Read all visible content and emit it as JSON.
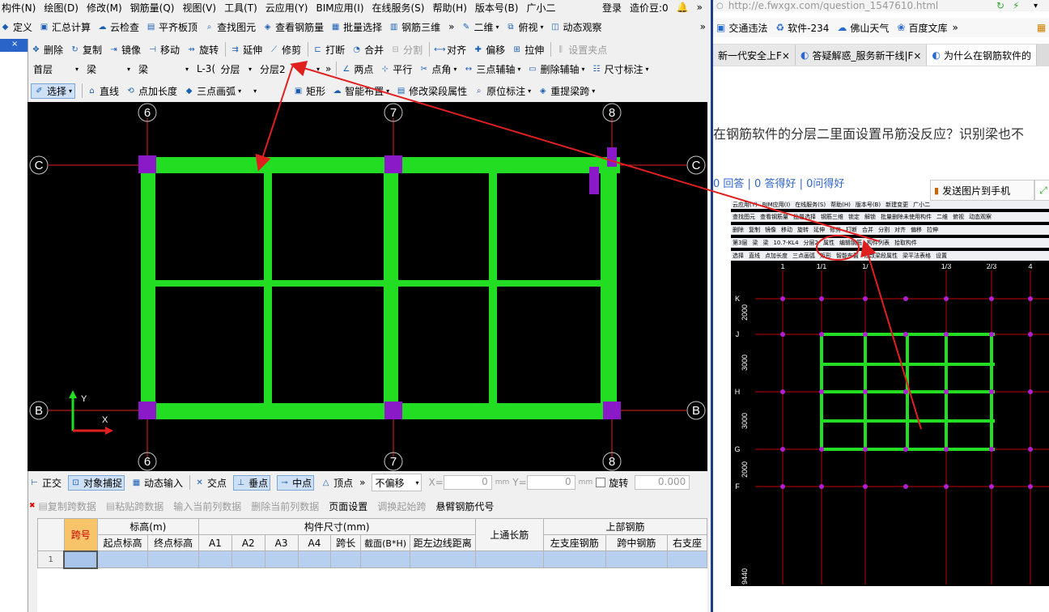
{
  "menubar": [
    "构件(N)",
    "绘图(D)",
    "修改(M)",
    "钢筋量(Q)",
    "视图(V)",
    "工具(T)",
    "云应用(Y)",
    "BIM应用(I)",
    "在线服务(S)",
    "帮助(H)",
    "版本号(B)",
    "广小二"
  ],
  "menubar_right": {
    "login": "登录",
    "coins": "造价豆:0"
  },
  "toolbar1": [
    {
      "label": "定义",
      "icon": "define-icon"
    },
    {
      "label": "汇总计算",
      "icon": "sigma-icon"
    },
    {
      "label": "云检查",
      "icon": "cloud-check-icon"
    },
    {
      "label": "平齐板顶",
      "icon": "align-slab-icon"
    },
    {
      "label": "查找图元",
      "icon": "find-icon"
    },
    {
      "label": "查看钢筋量",
      "icon": "view-rebar-icon"
    },
    {
      "label": "批量选择",
      "icon": "batch-select-icon"
    },
    {
      "label": "钢筋三维",
      "icon": "rebar-3d-icon"
    }
  ],
  "toolbar1_right": [
    {
      "label": "二维",
      "icon": "view-2d-icon"
    },
    {
      "label": "俯视",
      "icon": "top-view-icon"
    },
    {
      "label": "动态观察",
      "icon": "orbit-icon"
    }
  ],
  "toolbar2": [
    {
      "label": "删除",
      "icon": "delete-icon",
      "disabled": false
    },
    {
      "label": "复制",
      "icon": "copy-icon",
      "disabled": false
    },
    {
      "label": "镜像",
      "icon": "mirror-icon",
      "disabled": false
    },
    {
      "label": "移动",
      "icon": "move-icon",
      "disabled": false
    },
    {
      "label": "旋转",
      "icon": "rotate-icon",
      "disabled": false
    },
    {
      "label": "延伸",
      "icon": "extend-icon",
      "disabled": false
    },
    {
      "label": "修剪",
      "icon": "trim-icon",
      "disabled": false
    },
    {
      "label": "打断",
      "icon": "break-icon",
      "disabled": false
    },
    {
      "label": "合并",
      "icon": "merge-icon",
      "disabled": false
    },
    {
      "label": "分割",
      "icon": "split-icon",
      "disabled": true
    },
    {
      "label": "对齐",
      "icon": "align-icon",
      "disabled": false
    },
    {
      "label": "偏移",
      "icon": "offset-icon",
      "disabled": false
    },
    {
      "label": "拉伸",
      "icon": "stretch-icon",
      "disabled": false
    },
    {
      "label": "设置夹点",
      "icon": "grip-icon",
      "disabled": true
    }
  ],
  "toolbar3": {
    "floor": "首层",
    "category": "梁",
    "type": "梁",
    "member": "L-3(",
    "layer_label": "分层",
    "layer_value": "分层2"
  },
  "toolbar3_tools": [
    {
      "label": "两点",
      "icon": "two-point-icon"
    },
    {
      "label": "平行",
      "icon": "parallel-icon"
    },
    {
      "label": "点角",
      "icon": "point-angle-icon"
    },
    {
      "label": "三点辅轴",
      "icon": "three-point-axis-icon"
    },
    {
      "label": "删除辅轴",
      "icon": "delete-axis-icon"
    },
    {
      "label": "尺寸标注",
      "icon": "dimension-icon"
    }
  ],
  "toolbar4": [
    {
      "label": "选择",
      "icon": "select-cursor-icon"
    },
    {
      "label": "直线",
      "icon": "line-icon"
    },
    {
      "label": "点加长度",
      "icon": "point-length-icon"
    },
    {
      "label": "三点画弧",
      "icon": "arc-icon"
    },
    {
      "label": "矩形",
      "icon": "rectangle-icon"
    },
    {
      "label": "智能布置",
      "icon": "smart-layout-icon"
    },
    {
      "label": "修改梁段属性",
      "icon": "edit-beam-icon"
    },
    {
      "label": "原位标注",
      "icon": "in-place-label-icon"
    },
    {
      "label": "重提梁跨",
      "icon": "re-span-icon"
    }
  ],
  "canvas": {
    "axis_top": [
      "6",
      "7",
      "8"
    ],
    "axis_bottom": [
      "6",
      "7",
      "8"
    ],
    "axis_left": [
      "C",
      "B"
    ],
    "axis_right": [
      "C",
      "B"
    ],
    "ucs_x": "X",
    "ucs_y": "Y",
    "colors": {
      "beam": "#22dd22",
      "column": "#8a1ac8",
      "gridline": "#e02020",
      "annotation_arrow": "#e02020"
    }
  },
  "statusbar": {
    "ortho": "正交",
    "snap": "对象捕捉",
    "dyn_input": "动态输入",
    "intersection": "交点",
    "perpendicular": "垂点",
    "midpoint": "中点",
    "vertex": "顶点",
    "offset_mode": "不偏移",
    "x_label": "X=",
    "x_value": "0",
    "y_label": "Y=",
    "y_value": "0",
    "unit": "mm",
    "rotate_label": "旋转",
    "rotate_value": "0.000"
  },
  "span_toolbar": [
    {
      "label": "复制跨数据",
      "disabled": true
    },
    {
      "label": "粘贴跨数据",
      "disabled": true
    },
    {
      "label": "输入当前列数据",
      "disabled": true
    },
    {
      "label": "删除当前列数据",
      "disabled": true
    },
    {
      "label": "页面设置",
      "disabled": false
    },
    {
      "label": "调换起始跨",
      "disabled": true
    },
    {
      "label": "悬臂钢筋代号",
      "disabled": false
    }
  ],
  "span_table": {
    "group_headers": {
      "span_no": "跨号",
      "elevation": "标高(m)",
      "size": "构件尺寸(mm)",
      "through_length": "上通长筋",
      "top_rebar": "上部钢筋"
    },
    "sub_headers": [
      "起点标高",
      "终点标高",
      "A1",
      "A2",
      "A3",
      "A4",
      "跨长",
      "截面(B*H)",
      "距左边线距离",
      "左支座钢筋",
      "跨中钢筋",
      "右支座"
    ],
    "row_number": "1"
  },
  "browser": {
    "url": "http://e.fwxgx.com/question_1547610.html",
    "bookmarks": [
      "交通违法",
      "软件-234",
      "佛山天气",
      "百度文库"
    ],
    "tabs": [
      "新一代安全上F×",
      "答疑解惑_服务新干线|F×",
      "为什么在钢筋软件的"
    ],
    "question_title": "在钢筋软件的分层二里面设置吊筋没反应？识别梁也不",
    "answer_stats": "0 回答 | 0 答得好 | 0问得好",
    "send_to_phone": "发送图片到手机",
    "shot_menu": [
      "云应用(Y)",
      "BIM应用(I)",
      "在线服务(S)",
      "帮助(H)",
      "版本号(B)",
      "新建变更",
      "广小二"
    ],
    "shot_toolbar": [
      "查找图元",
      "查看钢筋量",
      "批量选择",
      "钢筋三维",
      "锁定",
      "解锁",
      "批量删除未使用构件",
      "二维",
      "俯视",
      "动态观察"
    ],
    "shot_edit": [
      "删除",
      "复制",
      "镜像",
      "移动",
      "旋转",
      "延伸",
      "修剪",
      "打断",
      "合并",
      "分割",
      "对齐",
      "偏移",
      "拉伸"
    ],
    "shot_combo": [
      "第3层",
      "梁",
      "梁",
      "10.7-KL4",
      "分层2",
      "属性",
      "编辑钢筋",
      "构件列表",
      "拾取构件"
    ],
    "shot_draw": [
      "选择",
      "直线",
      "点加长度",
      "三点画弧",
      "矩形",
      "智能布置",
      "修改梁段属性",
      "梁平法表格",
      "设置"
    ],
    "shot_axis_top": [
      "1",
      "1/1",
      "1/",
      "1/3",
      "2/3",
      "4"
    ],
    "shot_axis_left": [
      "K",
      "J",
      "H",
      "G",
      "F"
    ],
    "shot_dims": [
      "2000",
      "3000",
      "3000",
      "2000",
      "9440"
    ]
  }
}
